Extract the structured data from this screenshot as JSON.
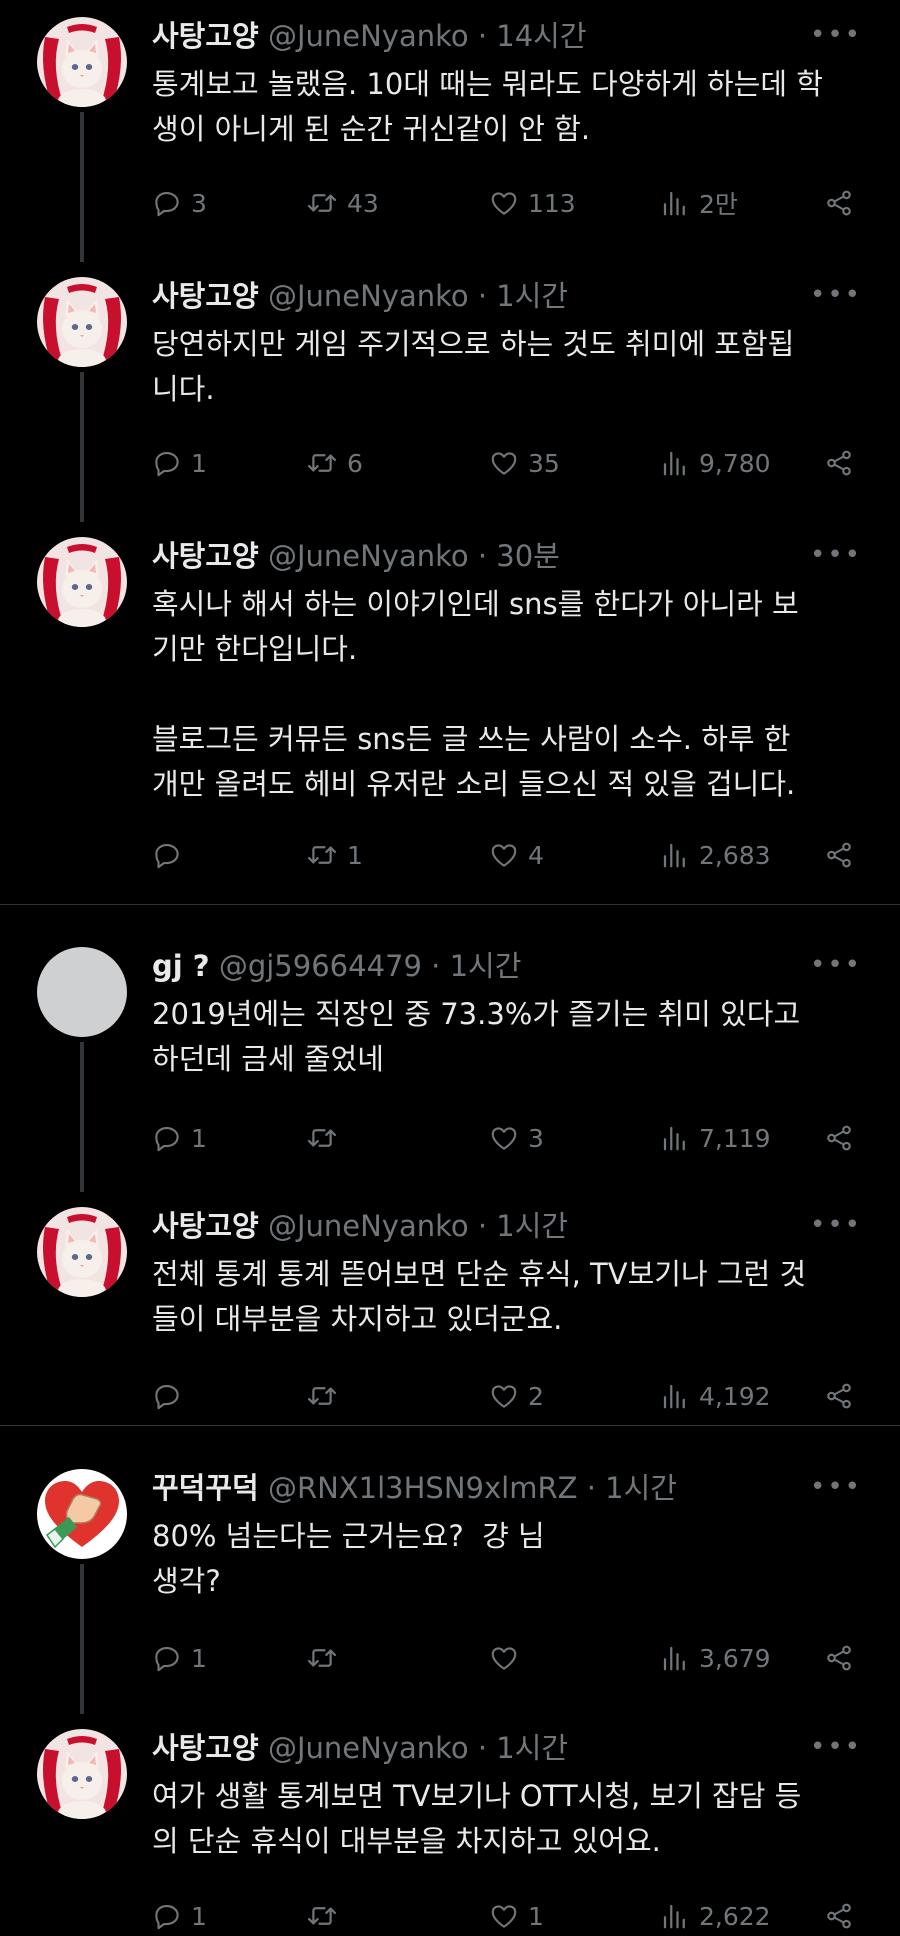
{
  "tweets": [
    {
      "name": "사탕고양",
      "handle": "@JuneNyanko",
      "time": "14시간",
      "text": "통계보고 놀랬음. 10대 때는 뭐라도 다양하게 하는데 학\n생이 아니게 된 순간 귀신같이 안 함.",
      "replies": "3",
      "retweets": "43",
      "likes": "113",
      "views": "2만",
      "avatar": "cat-avatar"
    },
    {
      "name": "사탕고양",
      "handle": "@JuneNyanko",
      "time": "1시간",
      "text": "당연하지만 게임 주기적으로 하는 것도 취미에 포함됩\n니다.",
      "replies": "1",
      "retweets": "6",
      "likes": "35",
      "views": "9,780",
      "avatar": "cat-avatar"
    },
    {
      "name": "사탕고양",
      "handle": "@JuneNyanko",
      "time": "30분",
      "text": "혹시나 해서 하는 이야기인데 sns를 한다가 아니라 보\n기만 한다입니다.\n\n블로그든 커뮤든 sns든 글 쓰는 사람이 소수. 하루 한\n개만 올려도 헤비 유저란 소리 들으신 적 있을 겁니다.",
      "replies": "",
      "retweets": "1",
      "likes": "4",
      "views": "2,683",
      "avatar": "cat-avatar"
    },
    {
      "name": "gj ?",
      "handle": "@gj59664479",
      "time": "1시간",
      "text": "2019년에는 직장인 중 73.3%가 즐기는 취미 있다고\n하던데 금세 줄었네",
      "replies": "1",
      "retweets": "",
      "likes": "3",
      "views": "7,119",
      "avatar": "default-avatar"
    },
    {
      "name": "사탕고양",
      "handle": "@JuneNyanko",
      "time": "1시간",
      "text": "전체 통계 통계 뜯어보면 단순 휴식, TV보기나 그런 것\n들이 대부분을 차지하고 있더군요.",
      "replies": "",
      "retweets": "",
      "likes": "2",
      "views": "4,192",
      "avatar": "cat-avatar"
    },
    {
      "name": "꾸덕꾸덕",
      "handle": "@RNX1l3HSN9xlmRZ",
      "time": "1시간",
      "text": "80% 넘는다는 근거는요?  걍 님\n생각?",
      "replies": "1",
      "retweets": "",
      "likes": "",
      "views": "3,679",
      "avatar": "heart-hand-avatar"
    },
    {
      "name": "사탕고양",
      "handle": "@JuneNyanko",
      "time": "1시간",
      "text": "여가 생활 통계보면 TV보기나 OTT시청, 보기 잡담 등\n의 단순 휴식이 대부분을 차지하고 있어요.",
      "replies": "1",
      "retweets": "",
      "likes": "1",
      "views": "2,622",
      "avatar": "cat-avatar"
    }
  ],
  "sep": "·",
  "more_label": "•••",
  "colors": {
    "background": "#000000",
    "text": "#e7e9ea",
    "muted": "#71767b",
    "divider": "#2f3336"
  }
}
